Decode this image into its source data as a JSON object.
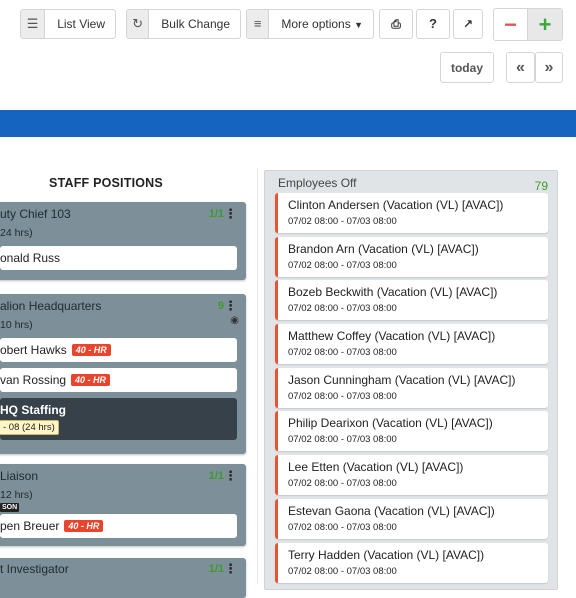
{
  "toolbar": {
    "list_view": "List View",
    "bulk_change": "Bulk Change",
    "more_options": "More options",
    "help": "?",
    "today": "today",
    "prev": "«",
    "next": "»",
    "minus": "−",
    "plus": "+"
  },
  "staff_positions": {
    "title": "STAFF POSITIONS",
    "cards": [
      {
        "name": "uty Chief 103",
        "hours": "24 hrs)",
        "count": "1/1",
        "slots": [
          {
            "text": "onald Russ"
          }
        ]
      },
      {
        "name": "alion Headquarters",
        "hours": "10 hrs)",
        "count": "9",
        "slots": [
          {
            "text": "obert Hawks",
            "tag": "40 - HR"
          },
          {
            "text": "van Rossing",
            "tag": "40 - HR"
          },
          {
            "text": "HQ Staffing",
            "sub": "- 08 (24 hrs)"
          }
        ]
      },
      {
        "name": "Liaison",
        "hours": "12 hrs)",
        "count": "1/1",
        "badge": "SON",
        "slots": [
          {
            "text": "pen Breuer",
            "tag": "40 - HR"
          }
        ]
      },
      {
        "name": "t Investigator",
        "count": "1/1"
      }
    ]
  },
  "employees_off": {
    "title": "Employees Off",
    "count": "79",
    "items": [
      {
        "name": "Clinton Andersen (Vacation (VL) [AVAC])",
        "time": "07/02 08:00 - 07/03 08:00"
      },
      {
        "name": "Brandon Arn (Vacation (VL) [AVAC])",
        "time": "07/02 08:00 - 07/03 08:00"
      },
      {
        "name": "Bozeb Beckwith (Vacation (VL) [AVAC])",
        "time": "07/02 08:00 - 07/03 08:00"
      },
      {
        "name": "Matthew Coffey (Vacation (VL) [AVAC])",
        "time": "07/02 08:00 - 07/03 08:00"
      },
      {
        "name": "Jason Cunningham (Vacation (VL) [AVAC])",
        "time": "07/02 08:00 - 07/03 08:00"
      },
      {
        "name": "Philip Dearixon (Vacation (VL) [AVAC])",
        "time": "07/02 08:00 - 07/03 08:00"
      },
      {
        "name": "Lee Etten (Vacation (VL) [AVAC])",
        "time": "07/02 08:00 - 07/03 08:00"
      },
      {
        "name": "Estevan Gaona (Vacation (VL) [AVAC])",
        "time": "07/02 08:00 - 07/03 08:00"
      },
      {
        "name": "Terry Hadden (Vacation (VL) [AVAC])",
        "time": "07/02 08:00 - 07/03 08:00"
      }
    ]
  },
  "colors": {
    "accent_blue": "#1565c0",
    "tag_red": "#e8452c",
    "count_green": "#3b9b2b"
  }
}
